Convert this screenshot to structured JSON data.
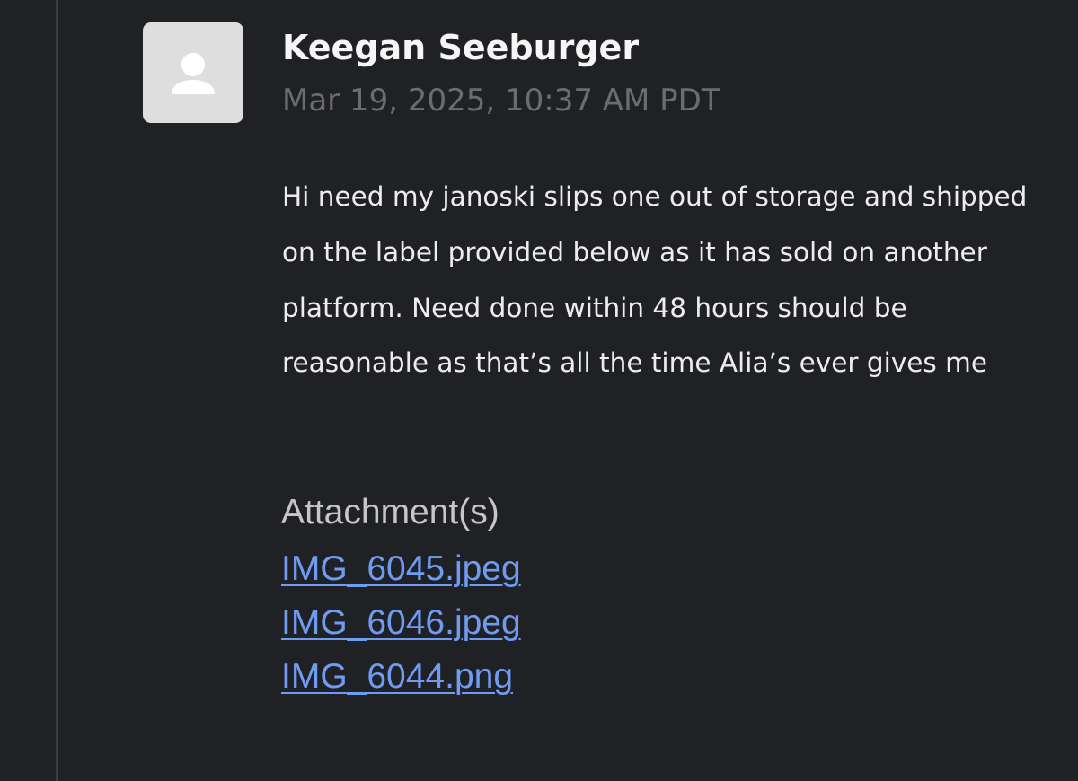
{
  "comment": {
    "author": "Keegan Seeburger",
    "timestamp": "Mar 19, 2025, 10:37 AM PDT",
    "avatar_icon": "user-silhouette-icon",
    "body": "Hi need my janoski slips one out of storage and shipped on the label provided below as it has sold on another platform. Need done within 48 hours should be reasonable as that’s all the time Alia’s ever gives me"
  },
  "attachments": {
    "heading": "Attachment(s)",
    "files": [
      {
        "name": "IMG_6045.jpeg"
      },
      {
        "name": "IMG_6046.jpeg"
      },
      {
        "name": "IMG_6044.png"
      }
    ]
  },
  "colors": {
    "background": "#202124",
    "author_text": "#f6f6f6",
    "timestamp_text": "#6b6c70",
    "body_text": "#ededed",
    "link": "#6f9bf3",
    "avatar_bg": "#dedede"
  }
}
